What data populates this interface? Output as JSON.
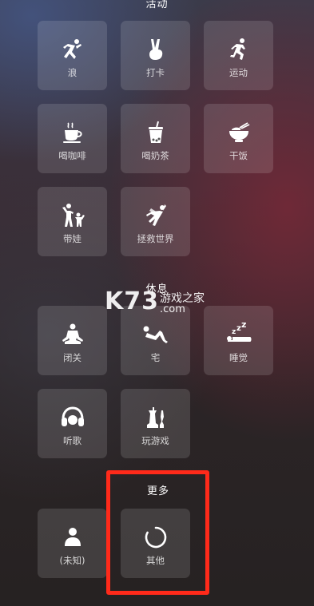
{
  "sections": {
    "top_partial_header": "活动",
    "rest_header": "休息",
    "more_header": "更多"
  },
  "activity_tiles": [
    {
      "label": "浪",
      "icon": "dancing-person-icon"
    },
    {
      "label": "打卡",
      "icon": "victory-hand-icon"
    },
    {
      "label": "运动",
      "icon": "running-person-icon"
    },
    {
      "label": "喝咖啡",
      "icon": "coffee-cup-icon"
    },
    {
      "label": "喝奶茶",
      "icon": "bubble-tea-icon"
    },
    {
      "label": "干饭",
      "icon": "rice-bowl-icon"
    },
    {
      "label": "带娃",
      "icon": "parent-child-icon"
    },
    {
      "label": "拯救世界",
      "icon": "superhero-icon"
    }
  ],
  "rest_tiles": [
    {
      "label": "闭关",
      "icon": "meditation-icon"
    },
    {
      "label": "宅",
      "icon": "lying-person-icon"
    },
    {
      "label": "睡觉",
      "icon": "sleeping-zzz-icon"
    },
    {
      "label": "听歌",
      "icon": "headphones-icon"
    },
    {
      "label": "玩游戏",
      "icon": "game-chess-icon"
    }
  ],
  "more_tiles": [
    {
      "label": "(未知)",
      "icon": "person-silhouette-icon"
    },
    {
      "label": "其他",
      "icon": "loading-ring-icon"
    }
  ],
  "watermark": {
    "logo": "K73",
    "text": "游戏之家",
    "domain": ".com"
  },
  "colors": {
    "highlight": "#ff2a1a",
    "tile_bg": "rgba(255,255,255,0.13)"
  }
}
